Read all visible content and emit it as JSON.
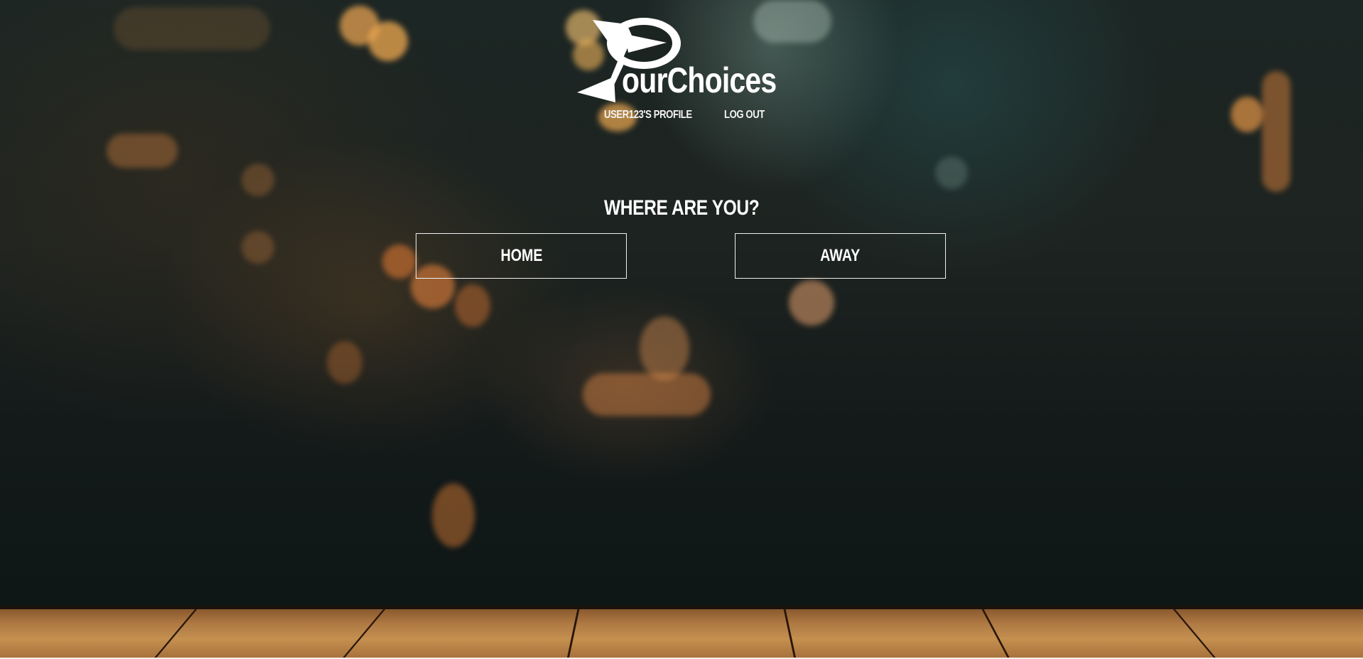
{
  "brand": {
    "logo_text": "ourChoices",
    "logo_icon": "cocktail-glass-icon"
  },
  "nav": {
    "profile_label": "USER123'S PROFILE",
    "logout_label": "LOG OUT"
  },
  "main": {
    "prompt": "WHERE ARE YOU?",
    "options": [
      {
        "label": "HOME"
      },
      {
        "label": "AWAY"
      }
    ]
  },
  "colors": {
    "text": "#ffffff",
    "button_border": "#f0f0f0",
    "background_dark": "#141a1a",
    "floor_wood": "#b07a44"
  }
}
